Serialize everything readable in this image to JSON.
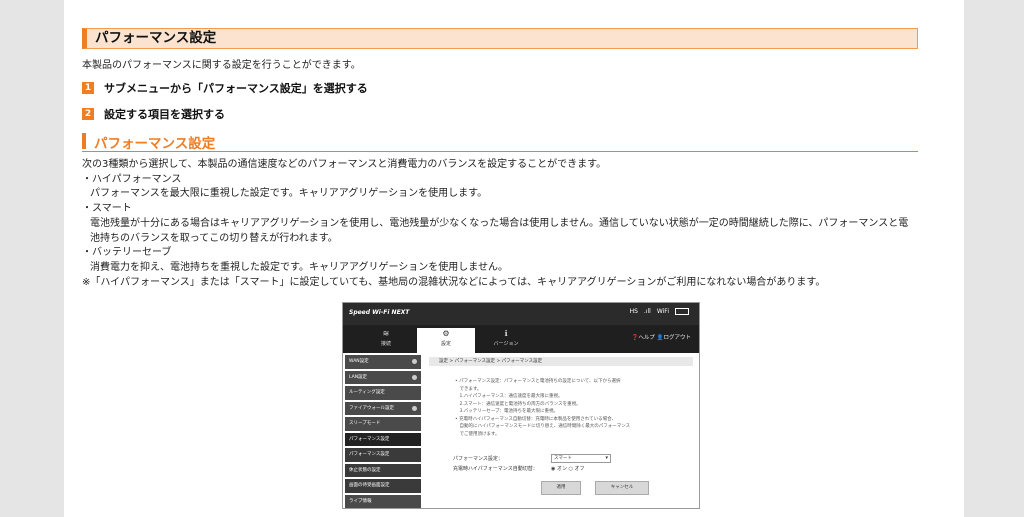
{
  "heading": "パフォーマンス設定",
  "intro": "本製品のパフォーマンスに関する設定を行うことができます。",
  "steps": [
    {
      "num": "1",
      "text": "サブメニューから「パフォーマンス設定」を選択する"
    },
    {
      "num": "2",
      "text": "設定する項目を選択する"
    }
  ],
  "section_title": "パフォーマンス設定",
  "body": {
    "lead": "次の3種類から選択して、本製品の通信速度などのパフォーマンスと消費電力のバランスを設定することができます。",
    "item1_title": "・ハイパフォーマンス",
    "item1_desc": "パフォーマンスを最大限に重視した設定です。キャリアアグリゲーションを使用します。",
    "item2_title": "・スマート",
    "item2_desc": "電池残量が十分にある場合はキャリアアグリゲーションを使用し、電池残量が少なくなった場合は使用しません。通信していない状態が一定の時間継続した際に、パフォーマンスと電池持ちのバランスを取ってこの切り替えが行われます。",
    "item3_title": "・バッテリーセーブ",
    "item3_desc": "消費電力を抑え、電池持ちを重視した設定です。キャリアアグリゲーションを使用しません。",
    "note": "※「ハイパフォーマンス」または「スマート」に設定していても、基地局の混雑状況などによっては、キャリアアグリゲーションがご利用になれない場合があります。"
  },
  "screenshot": {
    "logo": "Speed Wi-Fi NEXT",
    "status": [
      "HS",
      ".ıll",
      "WiFi"
    ],
    "tabs": [
      {
        "icon": "≋",
        "label": "接続"
      },
      {
        "icon": "⚙",
        "label": "設定"
      },
      {
        "icon": "ℹ",
        "label": "バージョン"
      }
    ],
    "help": "❓ヘルプ  👤ログアウト",
    "side_items": [
      "WAN設定",
      "LAN設定",
      "ルーティング設定",
      "ファイアウォール設定",
      "スリープモード",
      "パフォーマンス設定",
      "パフォーマンス設定",
      "休止状態の設定",
      "画面の待受画面設定",
      "ライブ情報"
    ],
    "breadcrumb": "設定 > パフォーマンス設定 > パフォーマンス設定",
    "desc_lines": [
      "• パフォーマンス設定：パフォーマンスと電池持ちの設定について、以下から選択",
      "　できます。",
      "　1.ハイパフォーマンス：通信速度を最大限に重視。",
      "　2.スマート：通信速度と電池持ちの両方のバランスを重視。",
      "　3.バッテリーセーブ：電池持ちを最大限に重視。",
      "• 充電時ハイパフォーマンス自動切替：充電時に本製品を使用されている場合、",
      "　自動的にハイパフォーマンスモードに切り替え、通信時間除く最大のパフォーマンス",
      "　でご使用頂けます。"
    ],
    "form_label1": "パフォーマンス設定：",
    "form_value1": "スマート",
    "form_label2": "充電時ハイパフォーマンス自動切替：",
    "form_value2": "◉ オン  ○ オフ",
    "apply": "適用",
    "cancel": "キャンセル"
  }
}
